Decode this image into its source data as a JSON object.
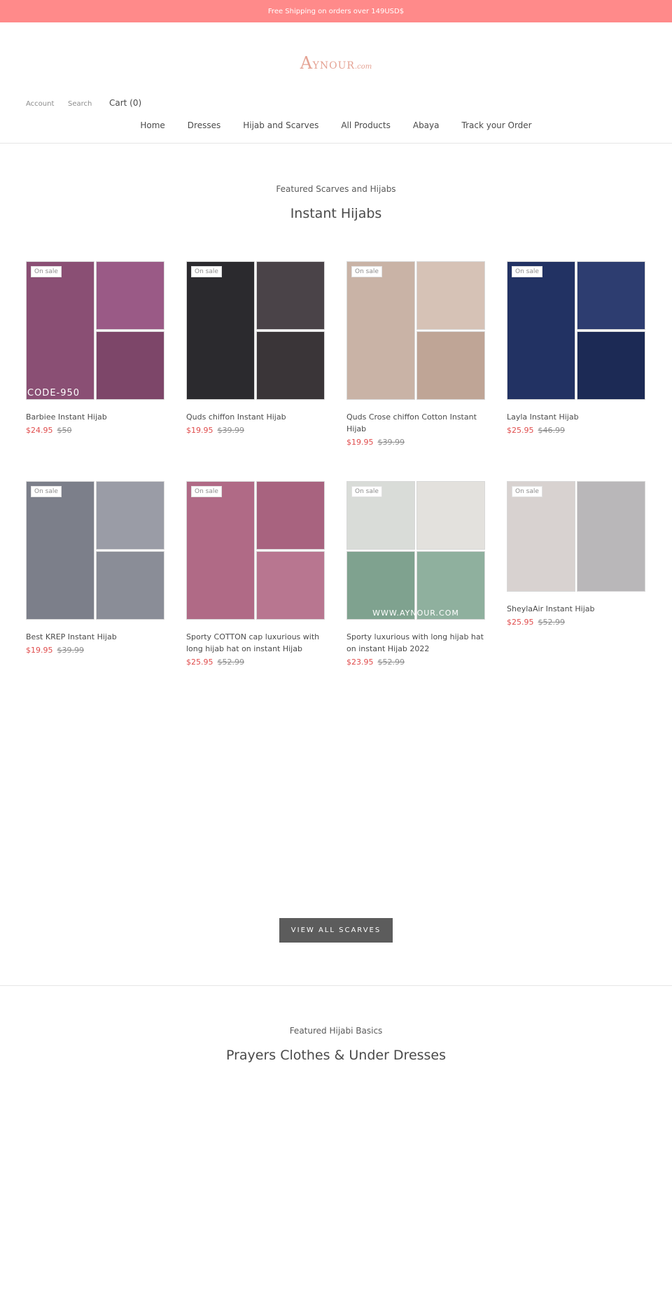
{
  "announcement": {
    "text": "Free Shipping on orders over 149USD$"
  },
  "logo": {
    "first_letter": "A",
    "rest": "YNOUR",
    "suffix": ".com"
  },
  "header": {
    "account_label": "Account",
    "search_label": "Search",
    "cart_label": "Cart (0)"
  },
  "nav": {
    "items": [
      "Home",
      "Dresses",
      "Hijab and Scarves",
      "All Products",
      "Abaya",
      "Track your Order"
    ]
  },
  "featured_scarves": {
    "subtitle": "Featured Scarves and Hijabs",
    "title": "Instant Hijabs",
    "button_label": "VIEW ALL SCARVES"
  },
  "products": [
    {
      "badge": "On sale",
      "title": "Barbiee Instant Hijab",
      "price": "$24.95",
      "compare_price": "$50",
      "overlay": "CODE-950",
      "colors": [
        "#8a4f74",
        "#9a5a86",
        "#7d4669"
      ]
    },
    {
      "badge": "On sale",
      "title": "Quds chiffon Instant Hijab",
      "price": "$19.95",
      "compare_price": "$39.99",
      "colors": [
        "#2b2a2e",
        "#4a4348",
        "#3a3538"
      ]
    },
    {
      "badge": "On sale",
      "title": "Quds Crose chiffon Cotton Instant Hijab",
      "price": "$19.95",
      "compare_price": "$39.99",
      "colors": [
        "#c9b3a6",
        "#d6c2b6",
        "#bfa596"
      ]
    },
    {
      "badge": "On sale",
      "title": "Layla Instant Hijab",
      "price": "$25.95",
      "compare_price": "$46.99",
      "colors": [
        "#223263",
        "#2d3d70",
        "#1c2a55"
      ]
    },
    {
      "badge": "On sale",
      "title": "Best KREP Instant Hijab",
      "price": "$19.95",
      "compare_price": "$39.99",
      "colors": [
        "#7c7f8a",
        "#9a9ca6",
        "#8a8d97"
      ]
    },
    {
      "badge": "On sale",
      "title": "Sporty COTTON cap luxurious with long hijab hat on instant Hijab",
      "price": "$25.95",
      "compare_price": "$52.99",
      "colors": [
        "#b06a86",
        "#a8637f",
        "#b87690"
      ]
    },
    {
      "badge": "On sale",
      "title": "Sporty luxurious with long hijab hat on instant Hijab 2022",
      "price": "$23.95",
      "compare_price": "$52.99",
      "overlay": "WWW.AYNOUR.COM",
      "colors": [
        "#d9dcd8",
        "#e3e1dd",
        "#7fa28f",
        "#8fb09e"
      ]
    },
    {
      "badge": "On sale",
      "title": "SheylaAir Instant Hijab",
      "price": "$25.95",
      "compare_price": "$52.99",
      "colors": [
        "#d8d2d0",
        "#b9b7b9"
      ]
    }
  ],
  "featured_basics": {
    "subtitle": "Featured Hijabi Basics",
    "title": "Prayers Clothes & Under Dresses"
  }
}
